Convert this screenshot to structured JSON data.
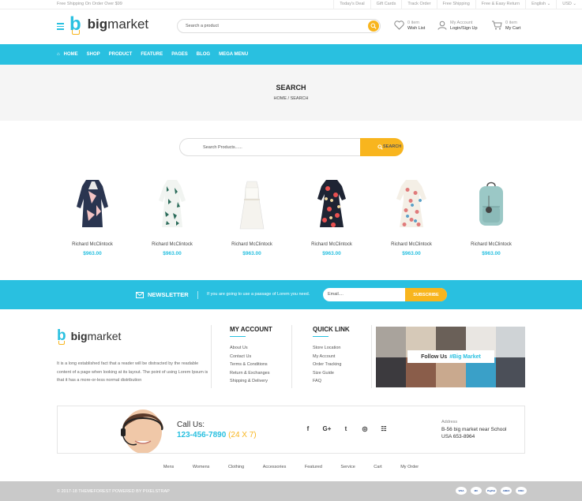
{
  "topbar": {
    "promo": "Free Shipping On Order Over $99",
    "links": [
      "Today's Deal",
      "Gift Cards",
      "Track Order",
      "Free Shipping",
      "Free & Easy Return",
      "English ⌄",
      "USD ⌄"
    ]
  },
  "header": {
    "logo_b": "b",
    "logo_text_bold": "big",
    "logo_text_rest": "market",
    "search_placeholder": "Search a product",
    "wishlist": {
      "top": "0 item",
      "bottom": "Wish List"
    },
    "account": {
      "top": "My Account",
      "bottom": "Login/Sign Up"
    },
    "cart": {
      "top": "0 item",
      "bottom": "My Cart"
    }
  },
  "nav": {
    "items": [
      "HOME",
      "SHOP",
      "PRODUCT",
      "FEATURE",
      "PAGES",
      "BLOG",
      "MEGA MENU"
    ]
  },
  "breadcrumb": {
    "title": "SEARCH",
    "path": "HOME  /  SEARCH"
  },
  "product_search": {
    "placeholder": "Search Products......",
    "button": "SEARCH"
  },
  "products": [
    {
      "name": "Richard McClintock",
      "price": "$963.00"
    },
    {
      "name": "Richard McClintock",
      "price": "$963.00"
    },
    {
      "name": "Richard McClintock",
      "price": "$963.00"
    },
    {
      "name": "Richard McClintock",
      "price": "$963.00"
    },
    {
      "name": "Richard McClintock",
      "price": "$963.00"
    },
    {
      "name": "Richard McClintock",
      "price": "$963.00"
    }
  ],
  "newsletter": {
    "title": "NEWSLETTER",
    "desc": "If you are going to use a passage of Lorem you need.",
    "placeholder": "Email....",
    "button": "SUBSCRIBE"
  },
  "footer": {
    "about": "It is a long established fact that a reader will be distracted by the readable content of a page when looking at its layout. The point of using Lorem Ipsum is that it has a more-or-less normal distribution",
    "account_title": "MY ACCOUNT",
    "account_links": [
      "About Us",
      "Contact Us",
      "Terms & Conditions",
      "Return & Exchanges",
      "Shipping & Delivery"
    ],
    "quick_title": "QUICK LINK",
    "quick_links": [
      "Store Location",
      "My Account",
      "Order Tracking",
      "Size Guide",
      "FAQ"
    ],
    "follow": "Follow Us",
    "follow_tag": "#Big Market"
  },
  "contact": {
    "call_label": "Call Us:",
    "phone": "123-456-7890",
    "hours": "(24 X 7)",
    "social": [
      "f",
      "G+",
      "t",
      "◎",
      "☷"
    ],
    "address_label": "Address",
    "address_line1": "B-56 big market near School",
    "address_line2": "USA 653-8964"
  },
  "footer_nav": [
    "Mens",
    "Womens",
    "Clothing",
    "Accessories",
    "Featured",
    "Service",
    "Cart",
    "My Order"
  ],
  "copyright": "© 2017-18 THEMEFOREST POWERED BY PIXELSTRAP",
  "payments": [
    "VISA",
    "MC",
    "PayPal",
    "AMEX",
    "DISC"
  ],
  "colors": {
    "accent": "#29c0e0",
    "highlight": "#f8b51e"
  }
}
